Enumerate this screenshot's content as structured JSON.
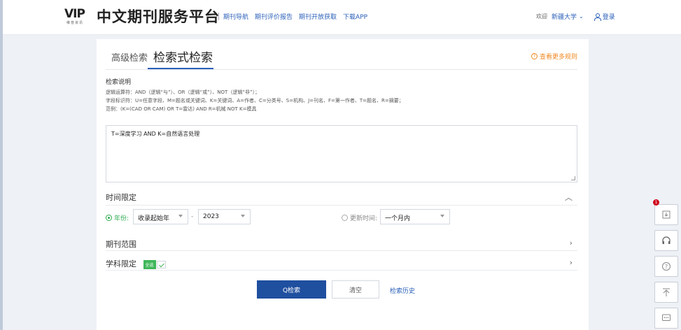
{
  "header": {
    "logo_text": "VIP",
    "logo_sub": "维普资讯",
    "site_title": "中文期刊服务平台",
    "nav": [
      "期刊导航",
      "期刊评价报告",
      "期刊开放获取",
      "下载APP"
    ],
    "welcome": "欢迎",
    "org": "新疆大学",
    "login": "登录"
  },
  "tabs": {
    "advanced": "高级检索",
    "expression": "检索式检索",
    "more_rules": "查看更多规则"
  },
  "help": {
    "title": "检索说明",
    "lines": [
      "逻辑运算符：AND（逻辑“与”）、OR（逻辑“或”）、NOT（逻辑“非”）；",
      "字段标识符：U=任意字段、M=题名或关键词、K=关键词、A=作者、C=分类号、S=机构、J=刊名、F=第一作者、T=题名、R=摘要；",
      "范例：(K=(CAD OR CAM) OR T=雷达) AND R=机械 NOT K=模具"
    ]
  },
  "query": {
    "value": "T=深度学习 AND K=自然语言处理"
  },
  "time_limit": {
    "title": "时间限定",
    "year_label": "年份:",
    "start_year": "收录起始年",
    "dash": "-",
    "end_year": "2023",
    "update_label": "更新时间:",
    "update_value": "一个月内"
  },
  "journal_range": {
    "title": "期刊范围"
  },
  "subject_limit": {
    "title": "学科限定",
    "all_label": "全选"
  },
  "actions": {
    "search": "Q检索",
    "clear": "清空",
    "history": "检索历史"
  },
  "side_tools": {
    "badge": "1",
    "icons": [
      "download-list-icon",
      "headset-icon",
      "help-icon",
      "back-to-top-icon",
      "chat-icon"
    ]
  },
  "colors": {
    "primary": "#1f4f9f",
    "link": "#2a5fb8",
    "accent_orange": "#f08a24",
    "green": "#3fb659"
  }
}
